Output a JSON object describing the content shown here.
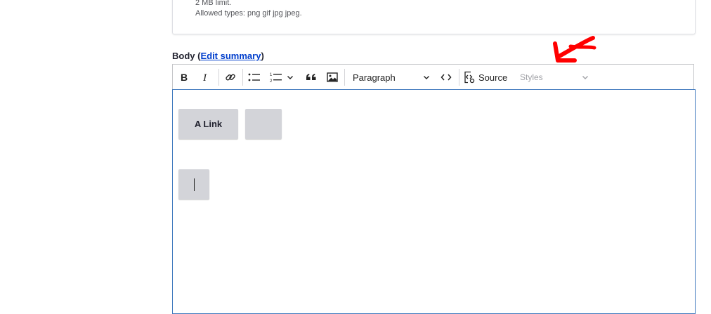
{
  "upload_description": {
    "line1": "2 MB limit.",
    "line2": "Allowed types: png gif jpg jpeg."
  },
  "body_field": {
    "label": "Body",
    "open_paren": " (",
    "edit_summary_link": "Edit summary",
    "close_paren": ")"
  },
  "toolbar": {
    "heading_select": "Paragraph",
    "source_label": "Source",
    "styles_select": "Styles",
    "icons": [
      "bold-icon",
      "italic-icon",
      "link-icon",
      "bulleted-list-icon",
      "numbered-list-icon",
      "chevron-down-icon",
      "blockquote-icon",
      "image-icon",
      "code-icon",
      "source-icon"
    ]
  },
  "editor": {
    "button1_label": "A Link",
    "button2_label": "",
    "button3_label": ""
  },
  "colors": {
    "link": "#003ecc",
    "editor_focus_border": "#3e78bd",
    "annotation_arrow": "#ff0000",
    "button_bg": "#d3d4d9"
  }
}
